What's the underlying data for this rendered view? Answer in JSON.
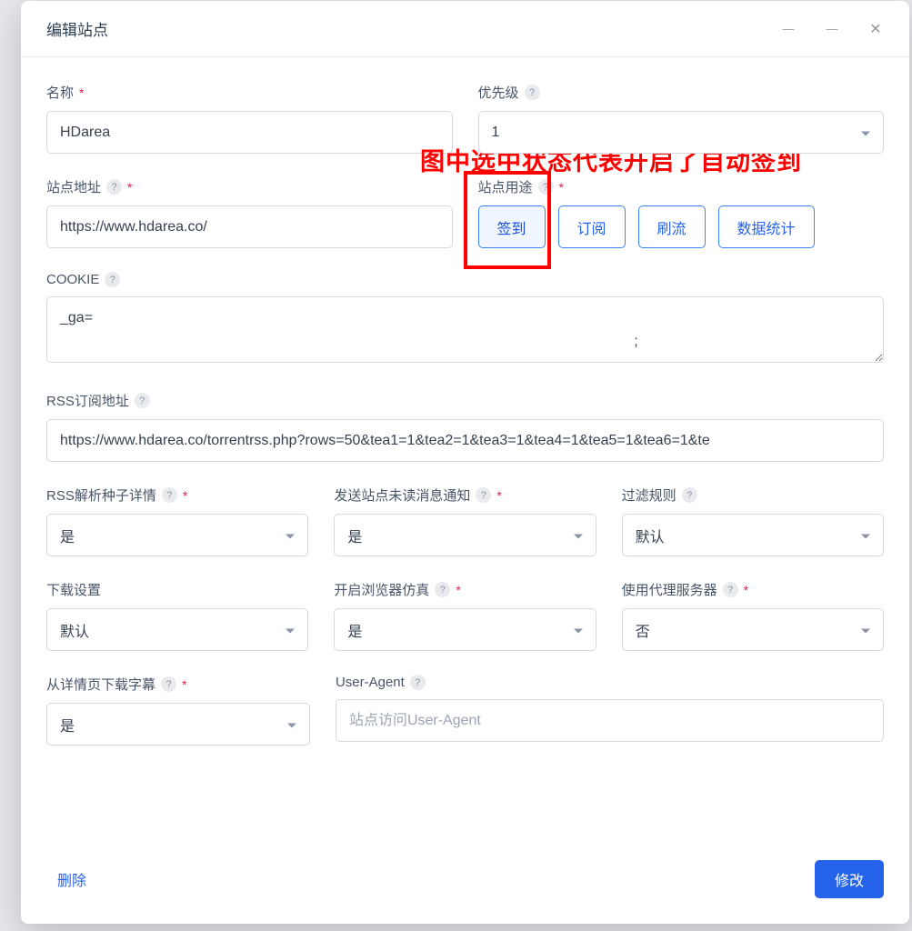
{
  "modal": {
    "title": "编辑站点",
    "annotation": "图中选中状态代表开启了自动签到"
  },
  "fields": {
    "name": {
      "label": "名称",
      "value": "HDarea"
    },
    "priority": {
      "label": "优先级",
      "value": "1"
    },
    "siteUrl": {
      "label": "站点地址",
      "value": "https://www.hdarea.co/"
    },
    "siteUsage": {
      "label": "站点用途",
      "options": [
        "签到",
        "订阅",
        "刷流",
        "数据统计"
      ]
    },
    "cookie": {
      "label": "COOKIE",
      "value": "_ga=\n                                                                                                                                              ;"
    },
    "rssUrl": {
      "label": "RSS订阅地址",
      "value": "https://www.hdarea.co/torrentrss.php?rows=50&tea1=1&tea2=1&tea3=1&tea4=1&tea5=1&tea6=1&te"
    },
    "rssParse": {
      "label": "RSS解析种子详情",
      "value": "是"
    },
    "sendNotify": {
      "label": "发送站点未读消息通知",
      "value": "是"
    },
    "filterRule": {
      "label": "过滤规则",
      "value": "默认"
    },
    "downloadSetting": {
      "label": "下载设置",
      "value": "默认"
    },
    "browserEmu": {
      "label": "开启浏览器仿真",
      "value": "是"
    },
    "useProxy": {
      "label": "使用代理服务器",
      "value": "否"
    },
    "downloadSubtitle": {
      "label": "从详情页下载字幕",
      "value": "是"
    },
    "userAgent": {
      "label": "User-Agent",
      "placeholder": "站点访问User-Agent",
      "value": ""
    }
  },
  "footer": {
    "delete": "删除",
    "save": "修改"
  }
}
